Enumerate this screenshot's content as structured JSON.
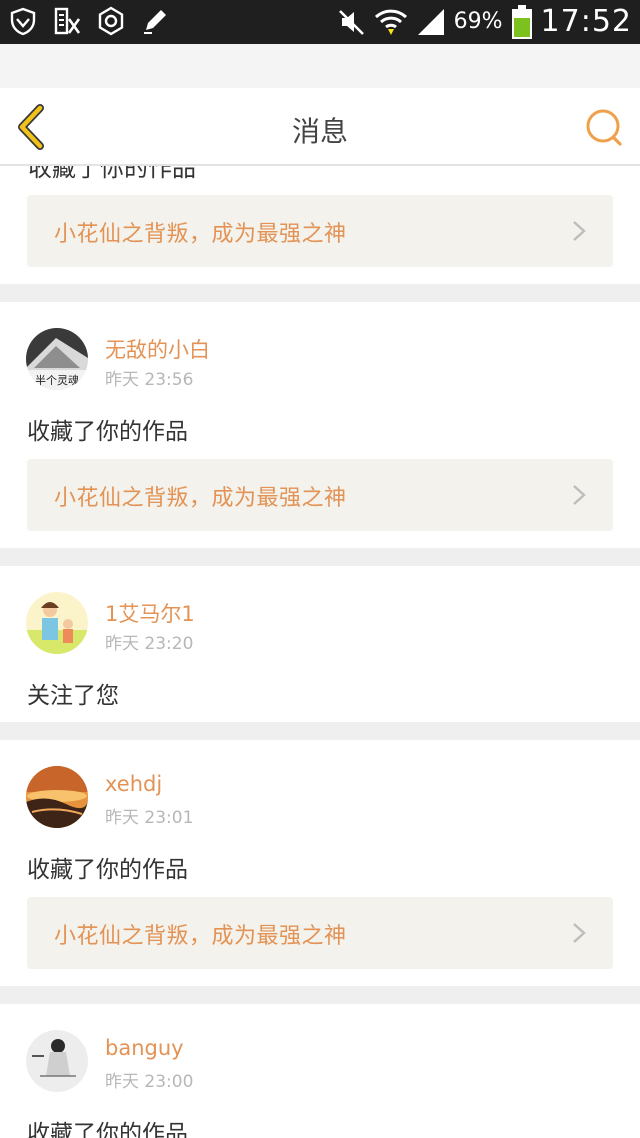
{
  "status_bar": {
    "battery_percent": "69%",
    "time": "17:52",
    "icons": [
      "shield-icon",
      "ime-keyboard-icon",
      "hexagon-settings-icon",
      "pencil-icon",
      "mute-icon",
      "wifi-icon",
      "signal-icon",
      "battery-icon"
    ]
  },
  "header": {
    "title": "消息",
    "back_icon": "back-chevron-icon",
    "search_icon": "search-icon"
  },
  "colors": {
    "accent_orange": "#e39355",
    "back_yellow": "#f0c21a",
    "link_bg": "#f3f2ec"
  },
  "feed": {
    "peek": {
      "action": "收藏了你的作品",
      "work": "小花仙之背叛，成为最强之神"
    },
    "items": [
      {
        "user": "无敌的小白",
        "time": "昨天 23:56",
        "action": "收藏了你的作品",
        "work": "小花仙之背叛，成为最强之神",
        "avatar_caption": "半个灵魂"
      },
      {
        "user": "1艾马尔1",
        "time": "昨天 23:20",
        "action": "关注了您"
      },
      {
        "user": "xehdj",
        "time": "昨天 23:01",
        "action": "收藏了你的作品",
        "work": "小花仙之背叛，成为最强之神"
      },
      {
        "user": "banguy",
        "time": "昨天 23:00",
        "action": "收藏了你的作品"
      }
    ]
  }
}
